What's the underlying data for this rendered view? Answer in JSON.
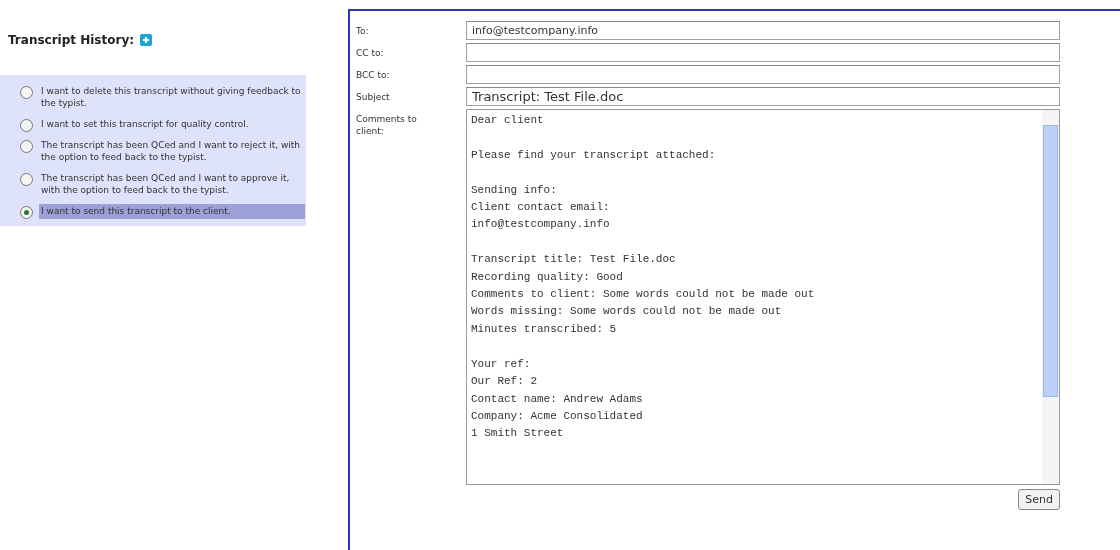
{
  "history": {
    "title": "Transcript History:",
    "options": [
      {
        "label": "I want to delete this transcript without giving feedback to the typist.",
        "selected": false
      },
      {
        "label": "I want to set this transcript for quality control.",
        "selected": false
      },
      {
        "label": "The transcript has been QCed and I want to reject it, with the option to feed back to the typist.",
        "selected": false
      },
      {
        "label": "The transcript has been QCed and I want to approve it, with the option to feed back to the typist.",
        "selected": false
      },
      {
        "label": "I want to send this transcript to the client.",
        "selected": true
      }
    ]
  },
  "email": {
    "fields": [
      {
        "label": "To:",
        "value": "info@testcompany.info"
      },
      {
        "label": "CC to:"
      },
      {
        "label": "BCC to:"
      },
      {
        "label": "Subject",
        "value": "Transcript: Test File.doc"
      }
    ],
    "comments_label": "Comments to client:",
    "comments": "Dear client\n\nPlease find your transcript attached:\n\nSending info:\nClient contact email:\ninfo@testcompany.info\n\nTranscript title: Test File.doc\nRecording quality: Good\nComments to client: Some words could not be made out\nWords missing: Some words could not be made out\nMinutes transcribed: 5\n\nYour ref:\nOur Ref: 2\nContact name: Andrew Adams\nCompany: Acme Consolidated\n1 Smith Street",
    "send": "Send"
  }
}
